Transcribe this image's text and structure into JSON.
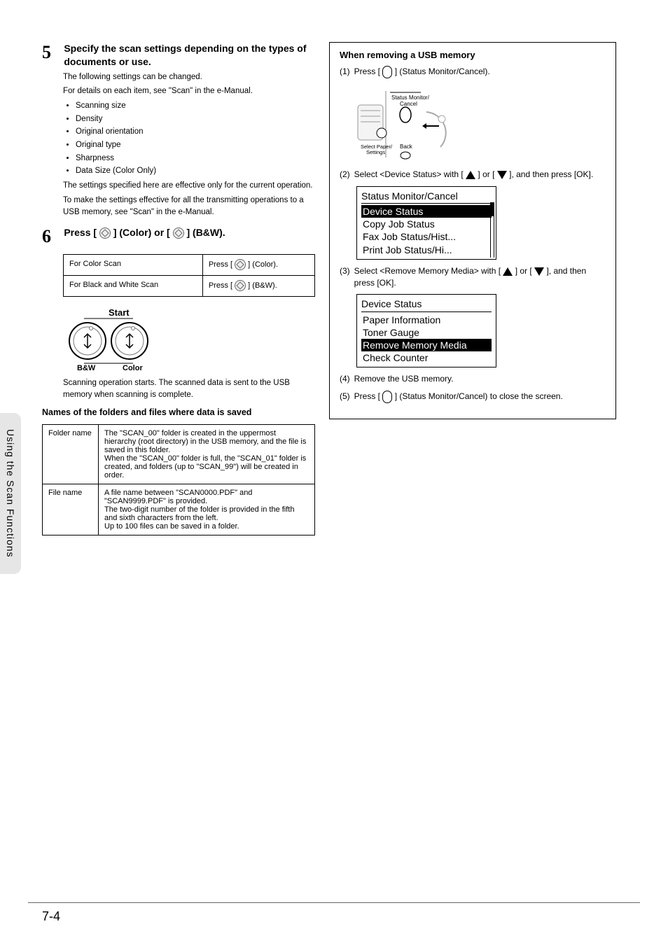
{
  "sidebar": {
    "label": "Using the Scan Functions"
  },
  "page_number": "7-4",
  "left": {
    "step5": {
      "num": "5",
      "title": "Specify the scan settings depending on the types of documents or use.",
      "intro1": "The following settings can be changed.",
      "intro2": "For details on each item, see \"Scan\" in the e-Manual.",
      "bullets": [
        "Scanning size",
        "Density",
        "Original orientation",
        "Original type",
        "Sharpness",
        "Data Size (Color Only)"
      ],
      "note1": "The settings specified here are effective only for the current operation.",
      "note2": "To make the settings effective for all the transmitting operations to a USB memory, see \"Scan\" in the e-Manual."
    },
    "step6": {
      "num": "6",
      "title_pre": "Press [ ",
      "title_mid1": " ] (Color) or [ ",
      "title_mid2": " ] (B&W).",
      "table": {
        "r1c1": "For Color Scan",
        "r1c2_pre": "Press [ ",
        "r1c2_post": " ] (Color).",
        "r2c1": "For Black and White Scan",
        "r2c2_pre": "Press [ ",
        "r2c2_post": " ] (B&W)."
      },
      "start_label": "Start",
      "bw_label": "B&W",
      "color_label": "Color",
      "after": "Scanning operation starts. The scanned data is sent to the USB memory when scanning is complete."
    },
    "names_section": {
      "heading": "Names of the folders and files where data is saved",
      "folder_label": "Folder name",
      "folder_text": "The \"SCAN_00\" folder is created in the uppermost hierarchy (root directory) in the USB memory, and the file is saved in this folder.\nWhen the \"SCAN_00\" folder is full, the \"SCAN_01\" folder is created, and folders (up to \"SCAN_99\") will be created in order.",
      "file_label": "File name",
      "file_text": "A file name between \"SCAN0000.PDF\" and \"SCAN9999.PDF\" is provided.\nThe two-digit number of the folder is provided in the fifth and sixth characters from the left.\nUp to 100 files can be saved in a folder."
    }
  },
  "right": {
    "callout_title": "When removing a USB memory",
    "s1": {
      "n": "(1)",
      "t_pre": "Press [ ",
      "t_post": " ] (Status Monitor/Cancel)."
    },
    "panel_labels": {
      "top": "Status Monitor/\nCancel",
      "left": "Select Paper/\nSettings",
      "right": "Back"
    },
    "s2": {
      "n": "(2)",
      "t_pre": "Select <Device Status> with [ ",
      "t_mid": " ] or [ ",
      "t_post": " ], and then press [OK]."
    },
    "lcd1": {
      "title": "Status Monitor/Cancel",
      "rows": [
        "Device Status",
        "Copy Job Status",
        "Fax Job Status/Hist...",
        "Print Job Status/Hi..."
      ],
      "selected": 0
    },
    "s3": {
      "n": "(3)",
      "t_pre": "Select <Remove Memory Media> with [ ",
      "t_mid": " ] or [ ",
      "t_post": " ], and then press [OK]."
    },
    "lcd2": {
      "title": "Device Status",
      "rows": [
        "Paper Information",
        "Toner Gauge",
        "Remove Memory Media",
        "Check Counter"
      ],
      "selected": 2
    },
    "s4": {
      "n": "(4)",
      "t": "Remove the USB memory."
    },
    "s5": {
      "n": "(5)",
      "t_pre": "Press [ ",
      "t_post": " ] (Status Monitor/Cancel) to close the screen."
    }
  }
}
